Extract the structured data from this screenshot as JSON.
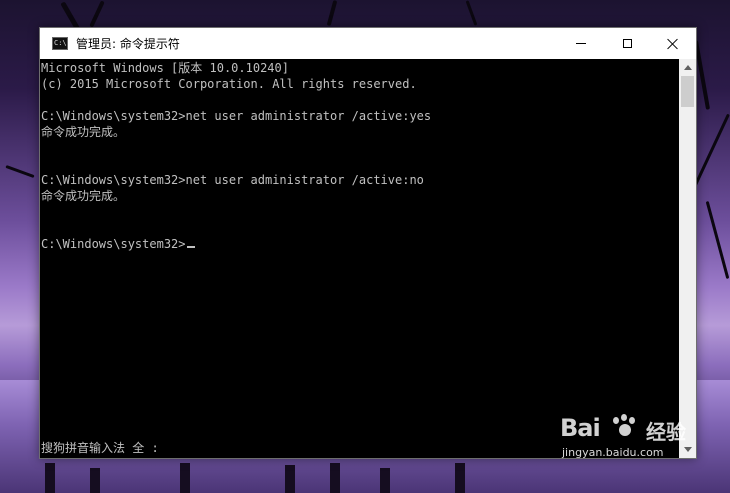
{
  "window": {
    "title": "管理员: 命令提示符",
    "icon": "console-icon",
    "controls": {
      "minimize": "minimize-icon",
      "maximize": "maximize-icon",
      "close": "close-icon"
    }
  },
  "console": {
    "lines": [
      "Microsoft Windows [版本 10.0.10240]",
      "(c) 2015 Microsoft Corporation. All rights reserved.",
      "",
      "C:\\Windows\\system32>net user administrator /active:yes",
      "命令成功完成。",
      "",
      "",
      "C:\\Windows\\system32>net user administrator /active:no",
      "命令成功完成。",
      "",
      "",
      "C:\\Windows\\system32>"
    ],
    "ime_status": "搜狗拼音输入法 全 :"
  },
  "watermark": {
    "logo_text": "Bai",
    "logo_suffix": "经验",
    "url": "jingyan.baidu.com"
  },
  "colors": {
    "console_bg": "#000000",
    "console_text": "#c0c0c0",
    "titlebar_bg": "#ffffff"
  }
}
